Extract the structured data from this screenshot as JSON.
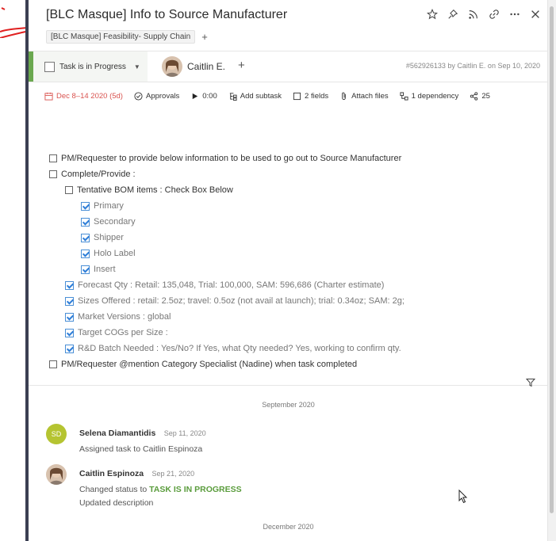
{
  "header": {
    "title": "[BLC Masque] Info to Source Manufacturer",
    "breadcrumb": "[BLC Masque] Feasibility- Supply Chain",
    "icons": [
      "star-icon",
      "pin-icon",
      "rss-icon",
      "link-icon",
      "more-icon",
      "close-icon"
    ]
  },
  "status_bar": {
    "status_label": "Task is in Progress",
    "assignee_name": "Caitlin E.",
    "task_meta": "#562926133 by Caitlin E. on Sep 10, 2020",
    "accent_color": "#6aa84f"
  },
  "toolbar": {
    "date": "Dec 8–14 2020 (5d)",
    "approvals": "Approvals",
    "timer": "0:00",
    "add_subtask": "Add subtask",
    "fields": "2 fields",
    "attach": "Attach files",
    "dependency": "1 dependency",
    "shares": "25"
  },
  "description": {
    "items": [
      "PM/Requester to provide below information to be used to go out to Source Manufacturer",
      "Complete/Provide :",
      "Tentative BOM items : Check Box Below",
      "Primary",
      "Secondary",
      "Shipper",
      "Holo Label",
      "Insert",
      "Forecast Qty : Retail: 135,048, Trial: 100,000, SAM: 596,686 (Charter estimate)",
      "Sizes Offered : retail: 2.5oz; travel: 0.5oz (not avail at launch); trial: 0.34oz; SAM: 2g;",
      "Market Versions : global",
      "Target COGs per Size :",
      "R&D Batch Needed : Yes/No? If Yes, what Qty needed? Yes, working to confirm qty.",
      "PM/Requester @mention Category Specialist (Nadine) when task completed"
    ]
  },
  "activity": {
    "month1": "September 2020",
    "month2": "December 2020",
    "entries": [
      {
        "initials": "SD",
        "name": "Selena Diamantidis",
        "time": "Sep 11, 2020",
        "text": "Assigned task to Caitlin Espinoza"
      },
      {
        "name": "Caitlin Espinoza",
        "time": "Sep 21, 2020",
        "text_prefix": "Changed status to",
        "status": "TASK IS IN PROGRESS",
        "text2": "Updated description"
      }
    ]
  }
}
